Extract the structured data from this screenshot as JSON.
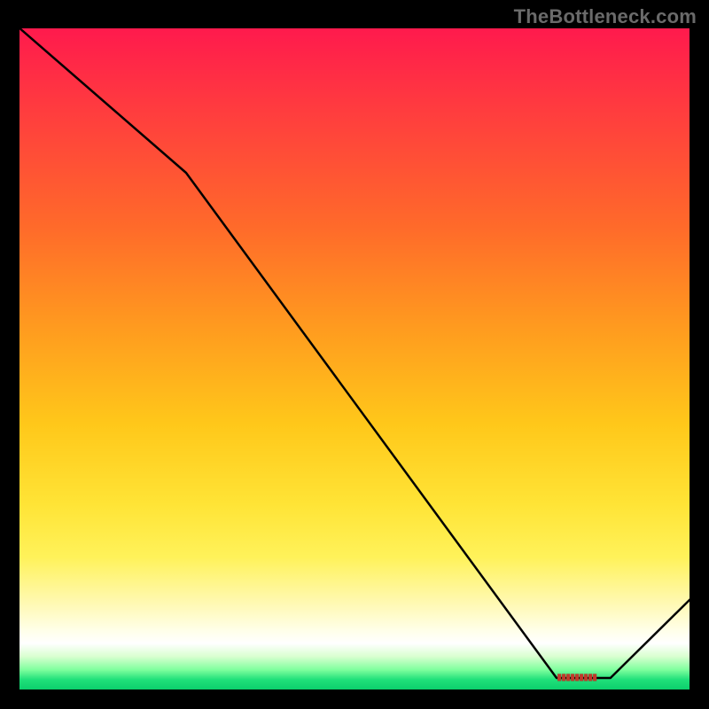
{
  "watermark": "TheBottleneck.com",
  "marker_label": "▮▮▮▮▮▮▮▮▮",
  "chart_data": {
    "type": "line",
    "title": "",
    "xlabel": "",
    "ylabel": "",
    "xlim": [
      0,
      100
    ],
    "ylim": [
      0,
      100
    ],
    "series": [
      {
        "name": "bottleneck-curve",
        "x": [
          0,
          25,
          80,
          88,
          100
        ],
        "y": [
          100,
          78,
          2,
          2,
          14
        ]
      }
    ],
    "annotations": [
      {
        "name": "optimal-marker",
        "x": 84,
        "y": 2
      }
    ],
    "background": {
      "type": "vertical-gradient",
      "stops": [
        {
          "pct": 0,
          "color": "#ff1a4d"
        },
        {
          "pct": 45,
          "color": "#ff9a1f"
        },
        {
          "pct": 72,
          "color": "#ffe436"
        },
        {
          "pct": 93,
          "color": "#ffffff"
        },
        {
          "pct": 100,
          "color": "#0ccf6c"
        }
      ]
    }
  }
}
